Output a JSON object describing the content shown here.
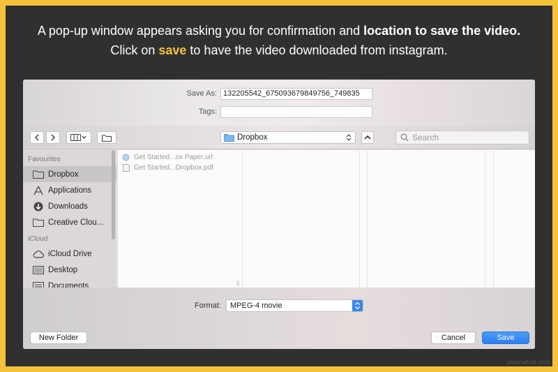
{
  "caption": {
    "line1_a": "A pop-up window appears asking you for confirmation and ",
    "line1_b": "location to save the video.",
    "line2_a": "Click on ",
    "line2_b": "save",
    "line2_c": " to have the video downloaded from instagram."
  },
  "dialog": {
    "save_as_label": "Save As:",
    "save_as_value": "132205542_675093679849756_749835",
    "tags_label": "Tags:",
    "tags_value": "",
    "location": "Dropbox",
    "search_placeholder": "Search"
  },
  "sidebar": {
    "favourites_label": "Favourites",
    "favourites": [
      {
        "label": "Dropbox",
        "icon": "folder-icon"
      },
      {
        "label": "Applications",
        "icon": "applications-icon"
      },
      {
        "label": "Downloads",
        "icon": "downloads-icon"
      },
      {
        "label": "Creative Clou...",
        "icon": "folder-icon"
      }
    ],
    "icloud_label": "iCloud",
    "icloud": [
      {
        "label": "iCloud Drive",
        "icon": "cloud-icon"
      },
      {
        "label": "Desktop",
        "icon": "desktop-icon"
      },
      {
        "label": "Documents",
        "icon": "documents-icon"
      }
    ]
  },
  "files": [
    {
      "name": "Get Started...ox Paper.url",
      "icon": "url-file-icon"
    },
    {
      "name": "Get Started...Dropbox.pdf",
      "icon": "pdf-file-icon"
    }
  ],
  "format": {
    "label": "Format:",
    "value": "MPEG-4 movie"
  },
  "buttons": {
    "new_folder": "New Folder",
    "cancel": "Cancel",
    "save": "Save"
  },
  "watermark": "www.wfvid.com",
  "colors": {
    "frame_border": "#f5c33b",
    "frame_bg": "#303030",
    "highlight": "#f5c33b",
    "primary_button": "#2c7ff0"
  }
}
